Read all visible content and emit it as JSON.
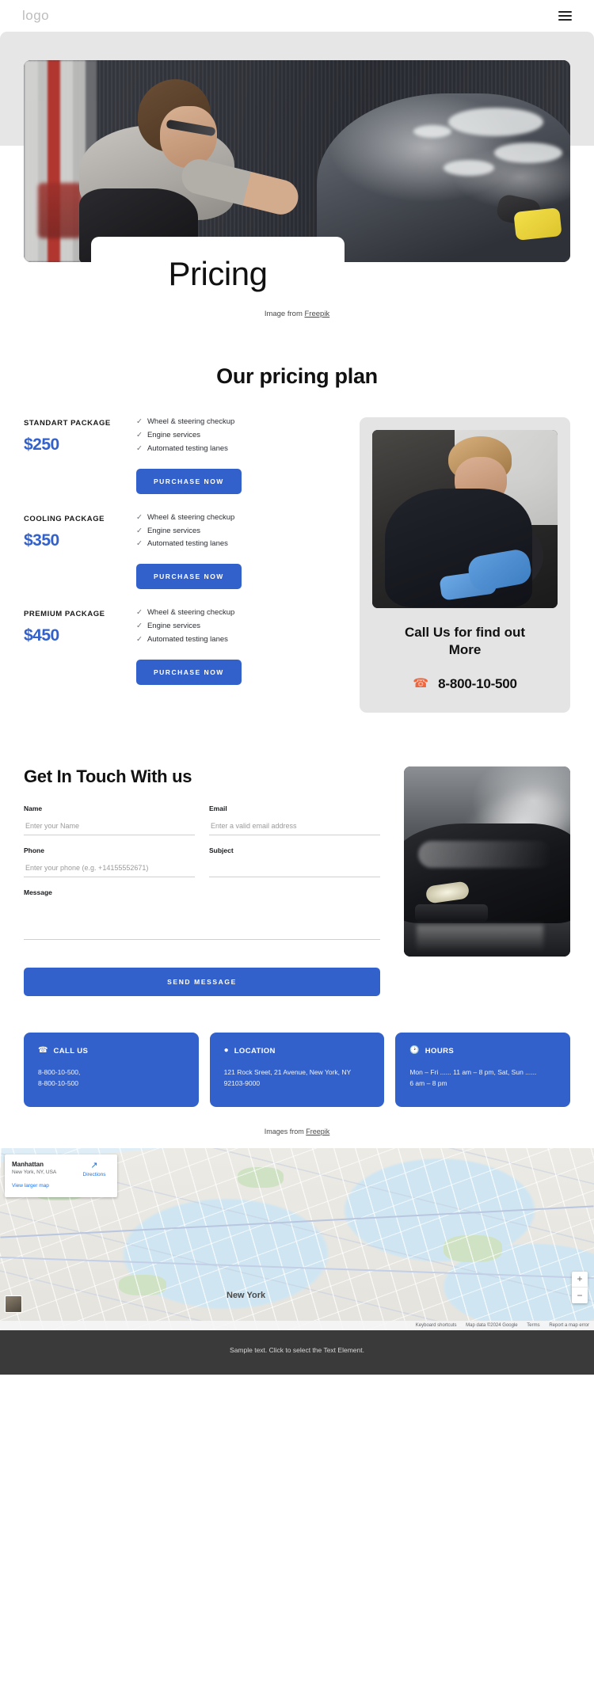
{
  "header": {
    "logo": "logo",
    "menu_icon": "hamburger-icon"
  },
  "hero": {
    "title": "Pricing",
    "credit_prefix": "Image from ",
    "credit_link": "Freepik"
  },
  "pricing": {
    "section_title": "Our pricing plan",
    "plans": [
      {
        "name": "STANDART  PACKAGE",
        "price": "$250",
        "features": [
          "Wheel & steering checkup",
          "Engine services",
          "Automated testing lanes"
        ],
        "cta": "PURCHASE NOW"
      },
      {
        "name": "COOLING PACKAGE",
        "price": "$350",
        "features": [
          "Wheel & steering checkup",
          "Engine services",
          "Automated testing lanes"
        ],
        "cta": "PURCHASE NOW"
      },
      {
        "name": "PREMIUM PACKAGE",
        "price": "$450",
        "features": [
          "Wheel & steering checkup",
          "Engine services",
          "Automated testing lanes"
        ],
        "cta": "PURCHASE NOW"
      }
    ],
    "call_card": {
      "title": "Call Us for find out More",
      "phone": "8-800-10-500",
      "phone_icon": "phone-icon"
    }
  },
  "contact": {
    "title": "Get In Touch With us",
    "fields": {
      "name_label": "Name",
      "name_placeholder": "Enter your Name",
      "email_label": "Email",
      "email_placeholder": "Enter a valid email address",
      "phone_label": "Phone",
      "phone_placeholder": "Enter your phone (e.g. +14155552671)",
      "subject_label": "Subject",
      "subject_placeholder": "",
      "message_label": "Message",
      "message_placeholder": ""
    },
    "submit": "SEND MESSAGE"
  },
  "info_cards": [
    {
      "icon": "phone-icon",
      "title": "CALL US",
      "lines": [
        "8-800-10-500,",
        "8-800-10-500"
      ]
    },
    {
      "icon": "location-pin-icon",
      "title": "LOCATION",
      "lines": [
        "121 Rock Sreet, 21 Avenue, New York, NY",
        "92103-9000"
      ]
    },
    {
      "icon": "clock-icon",
      "title": "HOURS",
      "lines": [
        "Mon – Fri ...... 11 am – 8 pm, Sat, Sun  ......",
        "6 am – 8 pm"
      ]
    }
  ],
  "images_credit": {
    "prefix": "Images from ",
    "link": "Freepik"
  },
  "map": {
    "card_title": "Manhattan",
    "card_subtitle": "New York, NY, USA",
    "card_link": "View larger map",
    "directions_label": "Directions",
    "place_label": "New York",
    "zoom_in": "+",
    "zoom_out": "−",
    "attr_shortcuts": "Keyboard shortcuts",
    "attr_data": "Map data ©2024 Google",
    "attr_terms": "Terms",
    "attr_report": "Report a map error"
  },
  "footer": {
    "text": "Sample text. Click to select the Text Element."
  },
  "colors": {
    "accent_blue": "#3361cc",
    "phone_orange": "#f2653a",
    "band_gray": "#e6e6e6",
    "card_gray": "#e4e4e4",
    "footer_gray": "#3a3a3a"
  }
}
